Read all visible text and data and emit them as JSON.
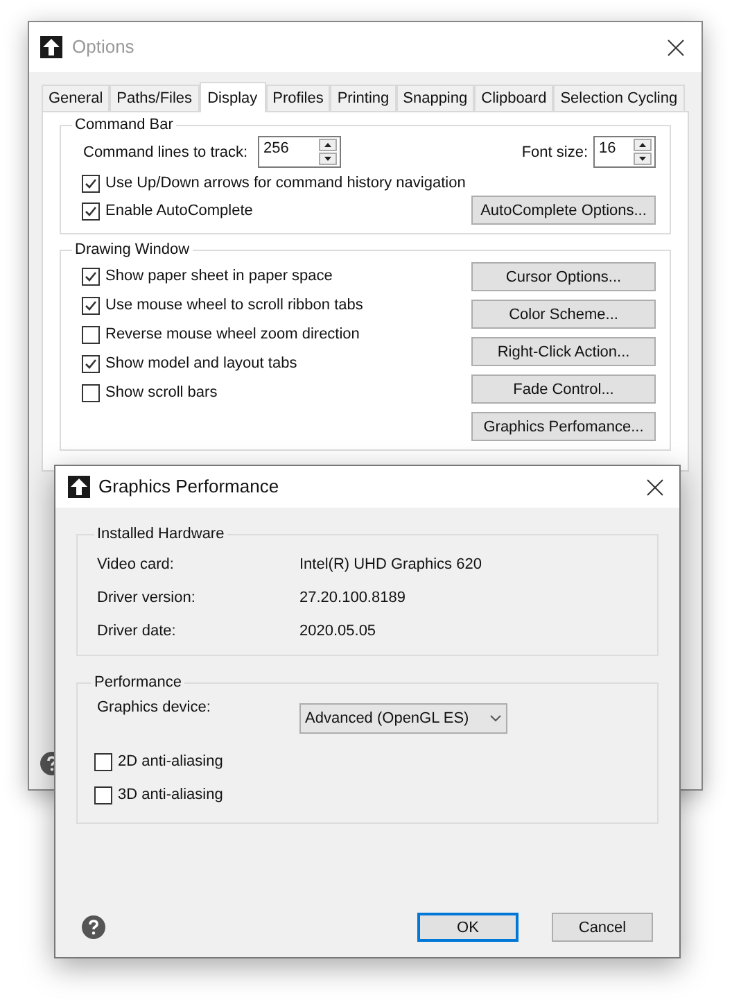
{
  "options_window": {
    "title": "Options",
    "tabs": [
      {
        "label": "General",
        "selected": false
      },
      {
        "label": "Paths/Files",
        "selected": false
      },
      {
        "label": "Display",
        "selected": true
      },
      {
        "label": "Profiles",
        "selected": false
      },
      {
        "label": "Printing",
        "selected": false
      },
      {
        "label": "Snapping",
        "selected": false
      },
      {
        "label": "Clipboard",
        "selected": false
      },
      {
        "label": "Selection Cycling",
        "selected": false
      }
    ],
    "command_bar": {
      "title": "Command Bar",
      "lines_label": "Command lines to track:",
      "lines_value": "256",
      "font_label": "Font size:",
      "font_value": "16",
      "checkboxes": [
        {
          "label": "Use Up/Down arrows for command history navigation",
          "checked": true
        },
        {
          "label": "Enable AutoComplete",
          "checked": true
        }
      ],
      "autocomplete_button": "AutoComplete Options..."
    },
    "drawing_window": {
      "title": "Drawing Window",
      "checkboxes": [
        {
          "label": "Show paper sheet in paper space",
          "checked": true
        },
        {
          "label": "Use mouse wheel to scroll ribbon tabs",
          "checked": true
        },
        {
          "label": "Reverse mouse wheel zoom direction",
          "checked": false
        },
        {
          "label": "Show model and layout tabs",
          "checked": true
        },
        {
          "label": "Show scroll bars",
          "checked": false
        }
      ],
      "buttons": [
        "Cursor Options...",
        "Color Scheme...",
        "Right-Click Action...",
        "Fade Control...",
        "Graphics Perfomance..."
      ]
    }
  },
  "graphics_dialog": {
    "title": "Graphics Performance",
    "hardware": {
      "title": "Installed Hardware",
      "rows": [
        {
          "label": "Video card:",
          "value": "Intel(R) UHD Graphics 620"
        },
        {
          "label": "Driver version:",
          "value": "27.20.100.8189"
        },
        {
          "label": "Driver date:",
          "value": "2020.05.05"
        }
      ]
    },
    "performance": {
      "title": "Performance",
      "device_label": "Graphics device:",
      "device_value": "Advanced (OpenGL ES)",
      "checkboxes": [
        {
          "label": "2D anti-aliasing",
          "checked": false
        },
        {
          "label": "3D anti-aliasing",
          "checked": false
        }
      ]
    },
    "buttons": [
      {
        "label": "OK",
        "default": true
      },
      {
        "label": "Cancel",
        "default": false
      }
    ]
  }
}
